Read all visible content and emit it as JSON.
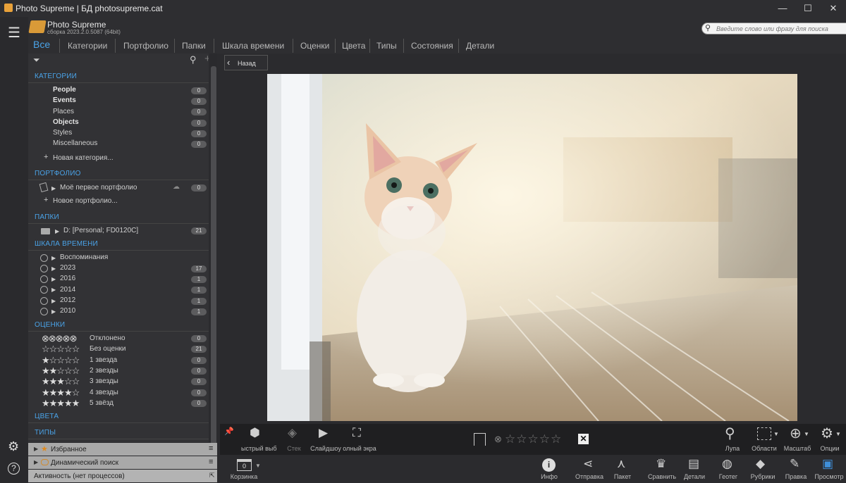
{
  "titlebar": {
    "title": "Photo Supreme | БД photosupreme.cat",
    "minimize": "—",
    "maximize": "☐",
    "close": "✕"
  },
  "app": {
    "name": "Photo Supreme",
    "build": "сборка 2023.2.0.5087 (64bit)"
  },
  "tabs": [
    "Все",
    "Категории",
    "Портфолио",
    "Папки",
    "Шкала времени",
    "Оценки",
    "Цвета",
    "Типы",
    "Состояния",
    "Детали"
  ],
  "search": {
    "placeholder": "Введите слово или фразу для поиска"
  },
  "sections": {
    "categories": {
      "title": "КАТЕГОРИИ",
      "items": [
        {
          "label": "People",
          "count": "0",
          "bold": true
        },
        {
          "label": "Events",
          "count": "0",
          "bold": true
        },
        {
          "label": "Places",
          "count": "0",
          "bold": false
        },
        {
          "label": "Objects",
          "count": "0",
          "bold": true
        },
        {
          "label": "Styles",
          "count": "0",
          "bold": false
        },
        {
          "label": "Miscellaneous",
          "count": "0",
          "bold": false
        }
      ],
      "add": "Новая категория..."
    },
    "portfolio": {
      "title": "ПОРТФОЛИО",
      "item": "Моё первое портфолио",
      "count": "0",
      "add": "Новое портфолио..."
    },
    "folders": {
      "title": "ПАПКИ",
      "item": "D:  [Personal; FD0120C]",
      "count": "21"
    },
    "timeline": {
      "title": "ШКАЛА ВРЕМЕНИ",
      "items": [
        {
          "label": "Воспоминания",
          "count": ""
        },
        {
          "label": "2023",
          "count": "17"
        },
        {
          "label": "2016",
          "count": "1"
        },
        {
          "label": "2014",
          "count": "1"
        },
        {
          "label": "2012",
          "count": "1"
        },
        {
          "label": "2010",
          "count": "1"
        }
      ]
    },
    "ratings": {
      "title": "ОЦЕНКИ",
      "items": [
        {
          "label": "Отклонено",
          "count": "0",
          "stars": "⊗⊗⊗⊗⊗"
        },
        {
          "label": "Без оценки",
          "count": "21",
          "stars": "☆☆☆☆☆"
        },
        {
          "label": "1 звезда",
          "count": "0",
          "stars": "★☆☆☆☆"
        },
        {
          "label": "2 звезды",
          "count": "0",
          "stars": "★★☆☆☆"
        },
        {
          "label": "3 звезды",
          "count": "0",
          "stars": "★★★☆☆"
        },
        {
          "label": "4 звезды",
          "count": "0",
          "stars": "★★★★☆"
        },
        {
          "label": "5 звёзд",
          "count": "0",
          "stars": "★★★★★"
        }
      ]
    },
    "colors": {
      "title": "ЦВЕТА"
    },
    "types": {
      "title": "ТИПЫ"
    }
  },
  "bottom_panels": {
    "favorites": "Избранное",
    "dynamic": "Динамический поиск",
    "activity": "Активность (нет процессов)"
  },
  "viewer": {
    "back": "Назад"
  },
  "toolbar1": {
    "quick": "ыстрый выб",
    "stack": "Стек",
    "slideshow": "Слайдшоу",
    "fullscreen": "олный экра",
    "loupe": "Лупа",
    "regions": "Области",
    "zoom": "Масштаб",
    "options": "Опции"
  },
  "toolbar2": {
    "basket": "Корзинка",
    "basket_count": "0",
    "info": "Инфо",
    "share": "Отправка",
    "batch": "Пакет",
    "compare": "Сравнить",
    "details": "Детали",
    "geotag": "Геотег",
    "rubrics": "Рубрики",
    "edit": "Правка",
    "view": "Просмотр"
  },
  "colors": {
    "accent": "#4aa3e8",
    "panel": "#323235",
    "background": "#2b2b2e"
  }
}
